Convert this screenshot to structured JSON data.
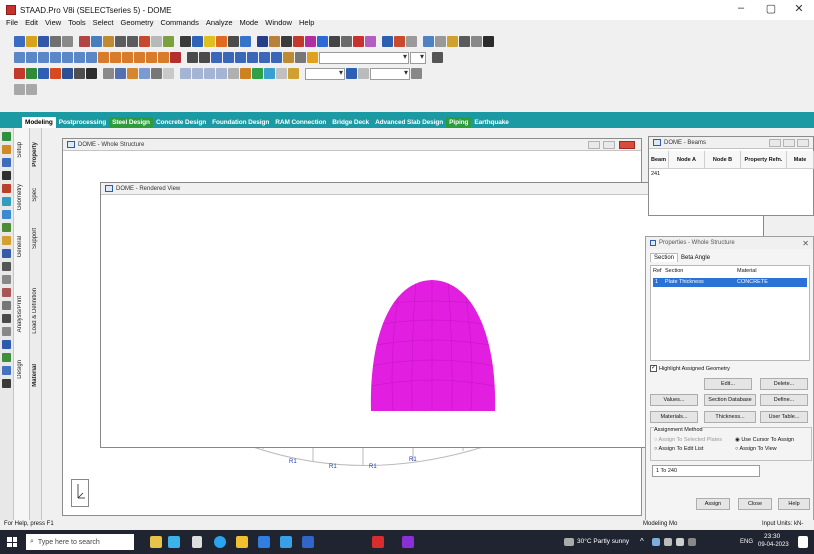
{
  "window": {
    "title": "STAAD.Pro V8i (SELECTseries 5) - DOME",
    "minimize": "–",
    "maximize": "▢",
    "close": "✕"
  },
  "menu": [
    "File",
    "Edit",
    "View",
    "Tools",
    "Select",
    "Geometry",
    "Commands",
    "Analyze",
    "Mode",
    "Window",
    "Help"
  ],
  "ribbon": {
    "tabs": [
      "Modeling",
      "Postprocessing",
      "Steel Design",
      "Concrete Design",
      "Foundation Design",
      "RAM Connection",
      "Bridge Deck",
      "Advanced Slab Design",
      "Piping",
      "Earthquake"
    ],
    "active": "Modeling"
  },
  "page_tabs": [
    "Setup",
    "Geometry",
    "General",
    "Analysis/Print",
    "Design"
  ],
  "sub_tabs": [
    "Property",
    "Spec",
    "Support",
    "Load & Definition",
    "Material"
  ],
  "whole_structure": {
    "title": "DOME - Whole Structure"
  },
  "rendered_view": {
    "title": "DOME - Rendered View",
    "shape_color": "#e21ee0"
  },
  "support_labels": [
    "R1",
    "R1",
    "R1",
    "R1"
  ],
  "beams": {
    "title": "DOME - Beams",
    "columns": [
      "Beam",
      "Node A",
      "Node B",
      "Property Refn.",
      "Mate"
    ],
    "row": [
      "241"
    ]
  },
  "properties": {
    "title": "Properties - Whole Structure",
    "tabs": [
      "Section",
      "Beta Angle"
    ],
    "columns": [
      "Ref",
      "Section",
      "Material"
    ],
    "row": {
      "ref": "1",
      "section": "Plate Thickness",
      "material": "CONCRETE"
    },
    "highlight_label": "Highlight Assigned Geometry",
    "highlight_checked": true,
    "buttons": {
      "edit": "Edit...",
      "delete": "Delete...",
      "values": "Values...",
      "section_database": "Section Database",
      "define": "Define...",
      "materials": "Materials...",
      "thickness": "Thickness...",
      "user_table": "User Table..."
    },
    "assignment": {
      "legend": "Assignment Method",
      "assign_selected": "Assign To Selected Plates",
      "assign_edit_list": "Assign To Edit List",
      "use_cursor": "Use Cursor To Assign",
      "assign_view": "Assign To View",
      "list_value": "1 To 240"
    },
    "assign": "Assign",
    "close": "Close",
    "help": "Help"
  },
  "status": {
    "left": "For Help, press F1",
    "mode": "Modeling Mo",
    "units": "Input Units: kN-"
  },
  "taskbar": {
    "search_placeholder": "Type here to search",
    "weather": "30°C  Partly sunny",
    "lang": "ENG",
    "time": "23:30",
    "date": "09-04-2023"
  },
  "colors": {
    "ribbon": "#1b9aa4",
    "dome": "#e21ee0",
    "taskbar": "#1f2430"
  }
}
